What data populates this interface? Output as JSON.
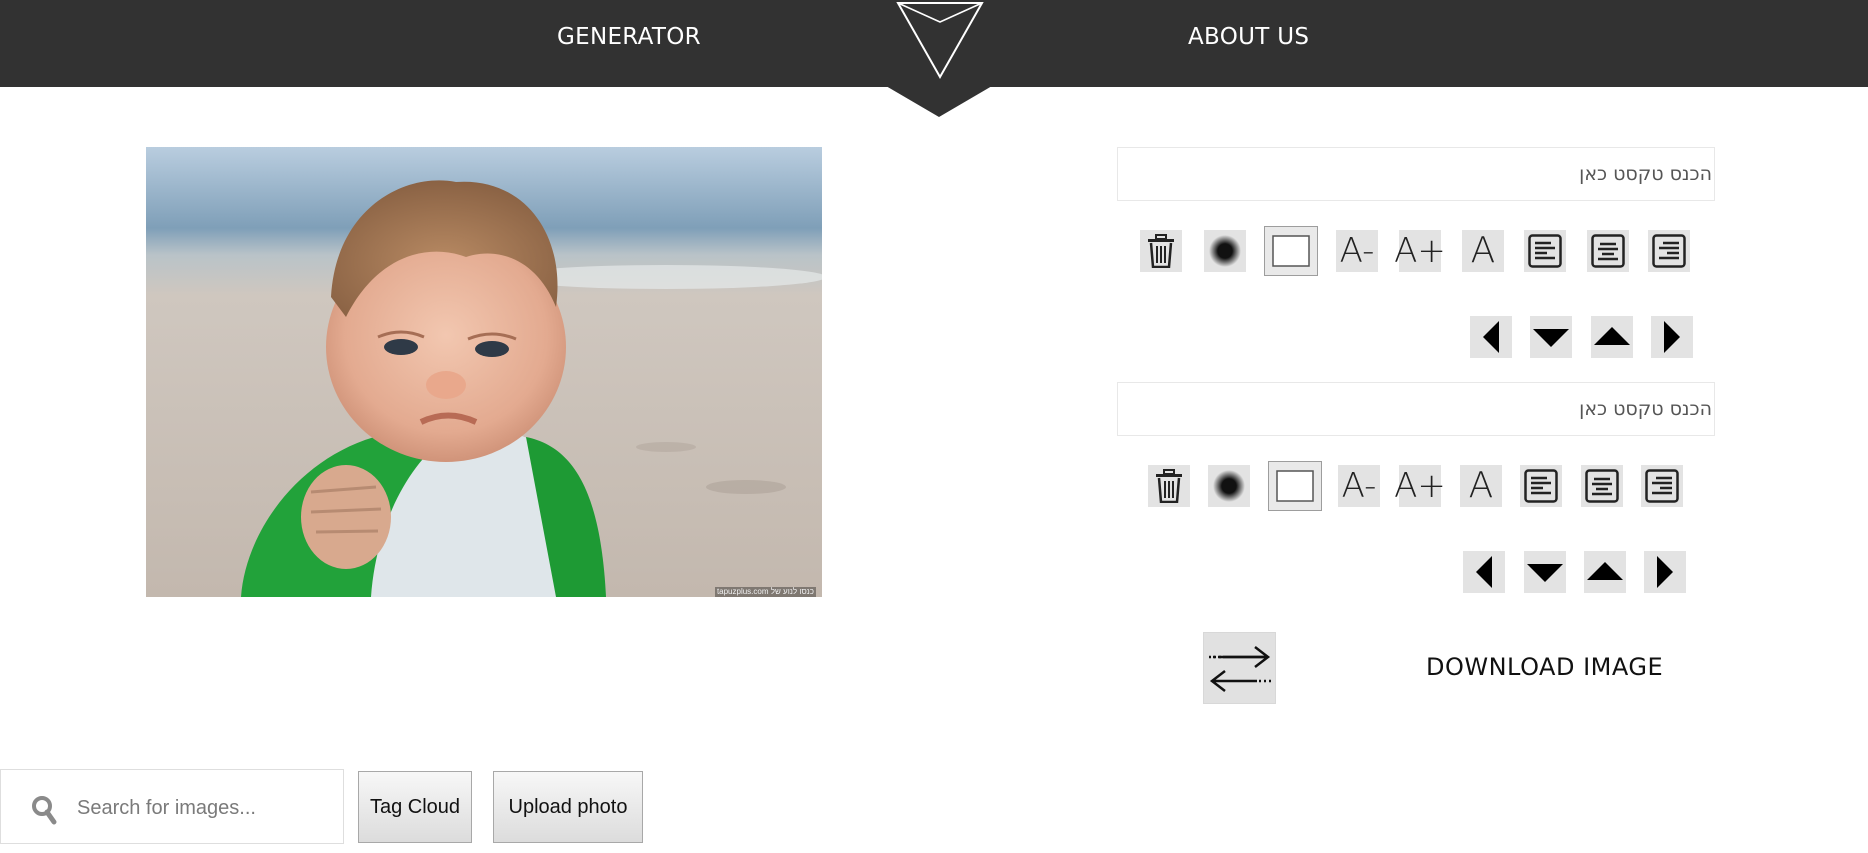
{
  "nav": {
    "generator_label": "GENERATOR",
    "about_label": "ABOUT US"
  },
  "meme": {
    "watermark": "tapuzplus.com כנסו לנוע של"
  },
  "editors": [
    {
      "placeholder": "הכנס טקסט כאן"
    },
    {
      "placeholder": "הכנס טקסט כאן"
    }
  ],
  "tools": {
    "font_decrease": "A-",
    "font_increase": "A+",
    "font_reset": "A"
  },
  "actions": {
    "download_label": "DOWNLOAD IMAGE"
  },
  "search": {
    "placeholder": "Search for images..."
  },
  "buttons": {
    "tag_cloud": "Tag Cloud",
    "upload_photo": "Upload photo"
  }
}
